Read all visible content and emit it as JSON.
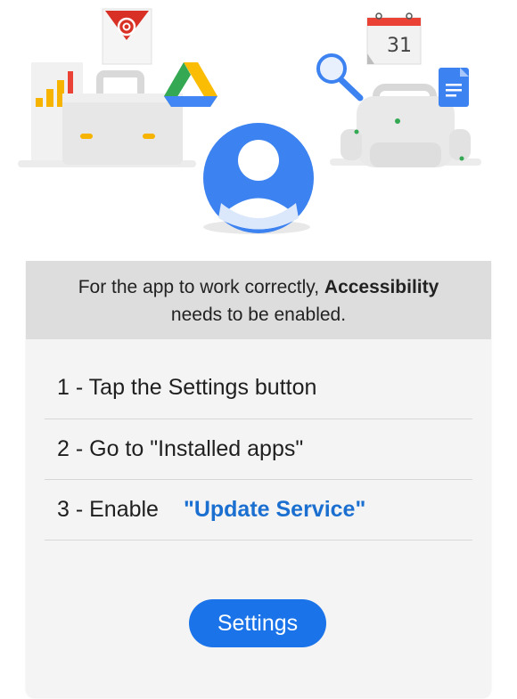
{
  "notice": {
    "line1_prefix": "For the app to work correctly, ",
    "line1_bold": "Accessibility",
    "line2": "needs to be enabled."
  },
  "steps": [
    {
      "text": "1 - Tap the Settings button"
    },
    {
      "text": "2 - Go to \"Installed apps\""
    },
    {
      "prefix": "3 - Enable",
      "highlight": "\"Update Service\""
    }
  ],
  "button": {
    "label": "Settings"
  },
  "illustration": {
    "calendar_day": "31",
    "icons": [
      "email-icon",
      "chart-icon",
      "briefcase-icon",
      "drive-icon",
      "user-avatar-icon",
      "calendar-icon",
      "magnifier-icon",
      "document-icon",
      "backpack-icon"
    ]
  },
  "colors": {
    "accent": "#1a73e8",
    "highlight": "#1a6fd0",
    "notice_bg": "#dddddd",
    "card_bg": "#f4f4f4"
  }
}
